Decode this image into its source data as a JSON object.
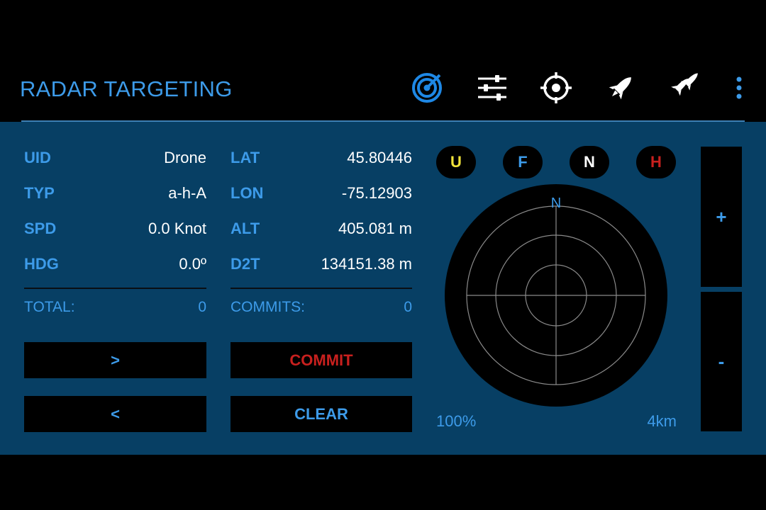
{
  "header": {
    "title": "RADAR TARGETING",
    "icons": [
      "radar-icon",
      "sliders-icon",
      "crosshair-icon",
      "rocket-icon",
      "missiles-icon",
      "more-vert-icon"
    ],
    "accent_color": "#3d9be9",
    "active_icon_color": "#1e88e5"
  },
  "info": {
    "uid_label": "UID",
    "uid_value": "Drone",
    "typ_label": "TYP",
    "typ_value": "a-h-A",
    "spd_label": "SPD",
    "spd_value": "0.0 Knot",
    "hdg_label": "HDG",
    "hdg_value": "0.0º",
    "lat_label": "LAT",
    "lat_value": "45.80446",
    "lon_label": "LON",
    "lon_value": "-75.12903",
    "alt_label": "ALT",
    "alt_value": "405.081 m",
    "d2t_label": "D2T",
    "d2t_value": "134151.38 m"
  },
  "counters": {
    "total_label": "TOTAL:",
    "total_value": "0",
    "commits_label": "COMMITS:",
    "commits_value": "0"
  },
  "buttons": {
    "next": ">",
    "prev": "<",
    "commit": "COMMIT",
    "clear": "CLEAR",
    "commit_color": "#c8201e"
  },
  "filters": [
    {
      "label": "U",
      "color": "#f2e33a"
    },
    {
      "label": "F",
      "color": "#3d9be9"
    },
    {
      "label": "N",
      "color": "#ffffff"
    },
    {
      "label": "H",
      "color": "#c8201e"
    }
  ],
  "radar": {
    "north_label": "N",
    "zoom_in": "+",
    "zoom_out": "-",
    "percent": "100%",
    "range": "4km"
  },
  "panel_color": "#073f64"
}
